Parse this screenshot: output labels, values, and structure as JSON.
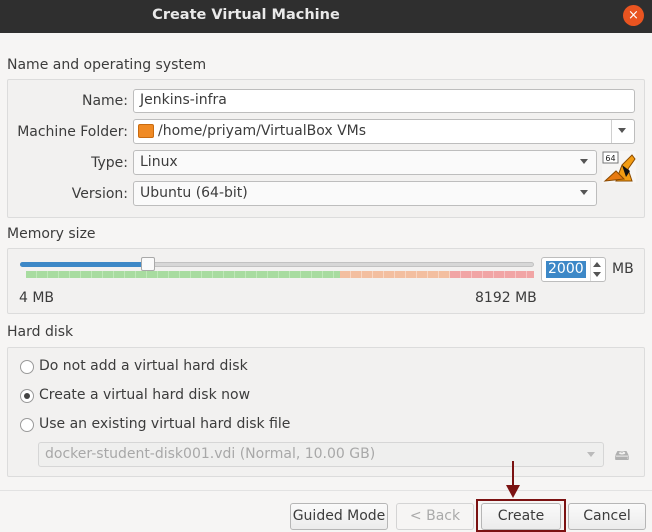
{
  "window": {
    "title": "Create Virtual Machine",
    "close_icon": "×"
  },
  "name_os": {
    "section_title": "Name and operating system",
    "name_label": "Name:",
    "name_value": "Jenkins-infra",
    "folder_label": "Machine Folder:",
    "folder_value": "/home/priyam/VirtualBox VMs",
    "type_label": "Type:",
    "type_value": "Linux",
    "version_label": "Version:",
    "version_value": "Ubuntu (64-bit)",
    "os_icon_badge": "64"
  },
  "memory": {
    "section_title": "Memory size",
    "min_label": "4 MB",
    "max_label": "8192 MB",
    "value": "2000",
    "unit": "MB",
    "slider_fraction": 0.244
  },
  "hard_disk": {
    "section_title": "Hard disk",
    "options": [
      {
        "label": "Do not add a virtual hard disk",
        "checked": false
      },
      {
        "label": "Create a virtual hard disk now",
        "checked": true
      },
      {
        "label": "Use an existing virtual hard disk file",
        "checked": false
      }
    ],
    "existing_file": "docker-student-disk001.vdi (Normal, 10.00 GB)"
  },
  "buttons": {
    "guided_mode": "Guided Mode",
    "back": "< Back",
    "create": "Create",
    "cancel": "Cancel"
  },
  "colors": {
    "accent": "#3d88c7",
    "close": "#e95420",
    "highlight": "#7b1212"
  }
}
